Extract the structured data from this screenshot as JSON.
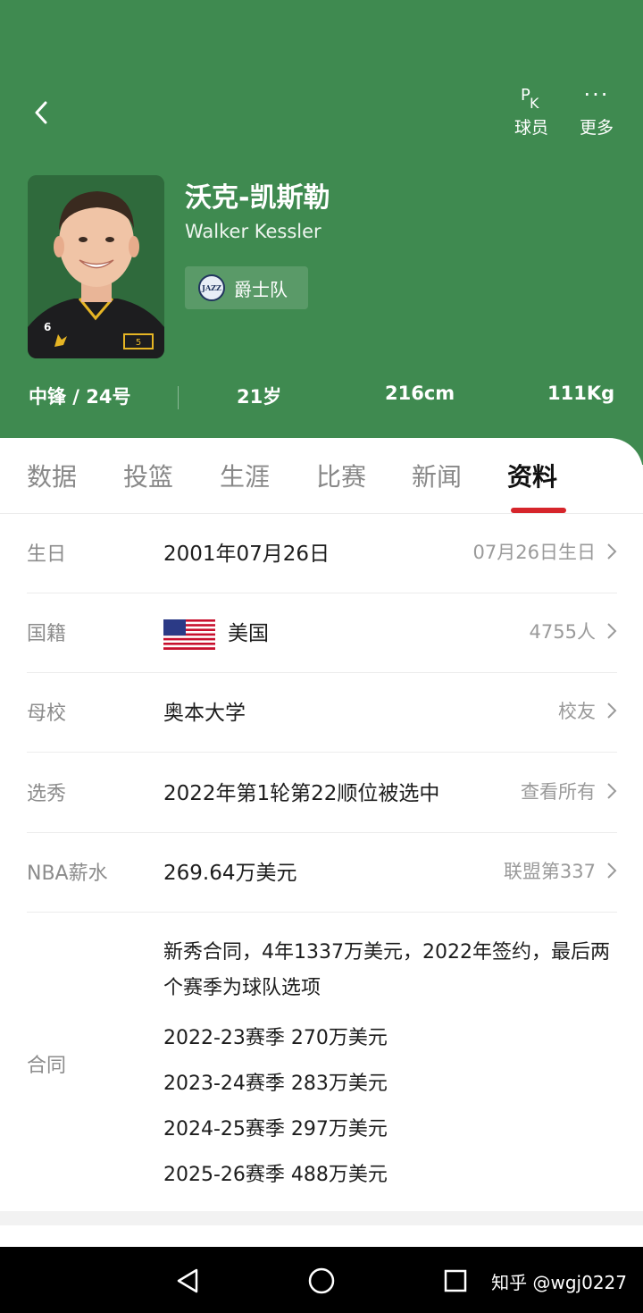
{
  "header": {
    "bg_color": "#3f8a50",
    "back_icon": "chevron-left-icon",
    "actions": [
      {
        "icon": "pk-icon",
        "label": "球员"
      },
      {
        "icon": "more-dots-icon",
        "label": "更多"
      }
    ],
    "pk_glyph_p": "P",
    "pk_glyph_k": "K",
    "more_glyph": "···"
  },
  "player": {
    "name_cn": "沃克-凯斯勒",
    "name_en": "Walker Kessler",
    "team": "爵士队",
    "team_logo_text": "JAZZ",
    "jersey_number": "6",
    "position_number": "中锋 / 24号",
    "age": "21岁",
    "height": "216cm",
    "weight": "111Kg"
  },
  "tabs": {
    "items": [
      "数据",
      "投篮",
      "生涯",
      "比赛",
      "新闻",
      "资料"
    ],
    "active": "资料",
    "accent": "#d6252b"
  },
  "info": {
    "birthday": {
      "label": "生日",
      "value": "2001年07月26日",
      "link": "07月26日生日"
    },
    "nationality": {
      "label": "国籍",
      "value": "美国",
      "link": "4755人"
    },
    "college": {
      "label": "母校",
      "value": "奥本大学",
      "link": "校友"
    },
    "draft": {
      "label": "选秀",
      "value": "2022年第1轮第22顺位被选中",
      "link": "查看所有"
    },
    "salary": {
      "label": "NBA薪水",
      "value": "269.64万美元",
      "link": "联盟第337"
    }
  },
  "contract": {
    "label": "合同",
    "summary": "新秀合同，4年1337万美元，2022年签约，最后两个赛季为球队选项",
    "seasons": [
      "2022-23赛季 270万美元",
      "2023-24赛季 283万美元",
      "2024-25赛季 297万美元",
      "2025-26赛季 488万美元"
    ]
  },
  "system_nav": {
    "buttons": [
      "back-triangle-icon",
      "home-circle-icon",
      "recents-square-icon"
    ],
    "watermark": "知乎 @wgj0227"
  }
}
